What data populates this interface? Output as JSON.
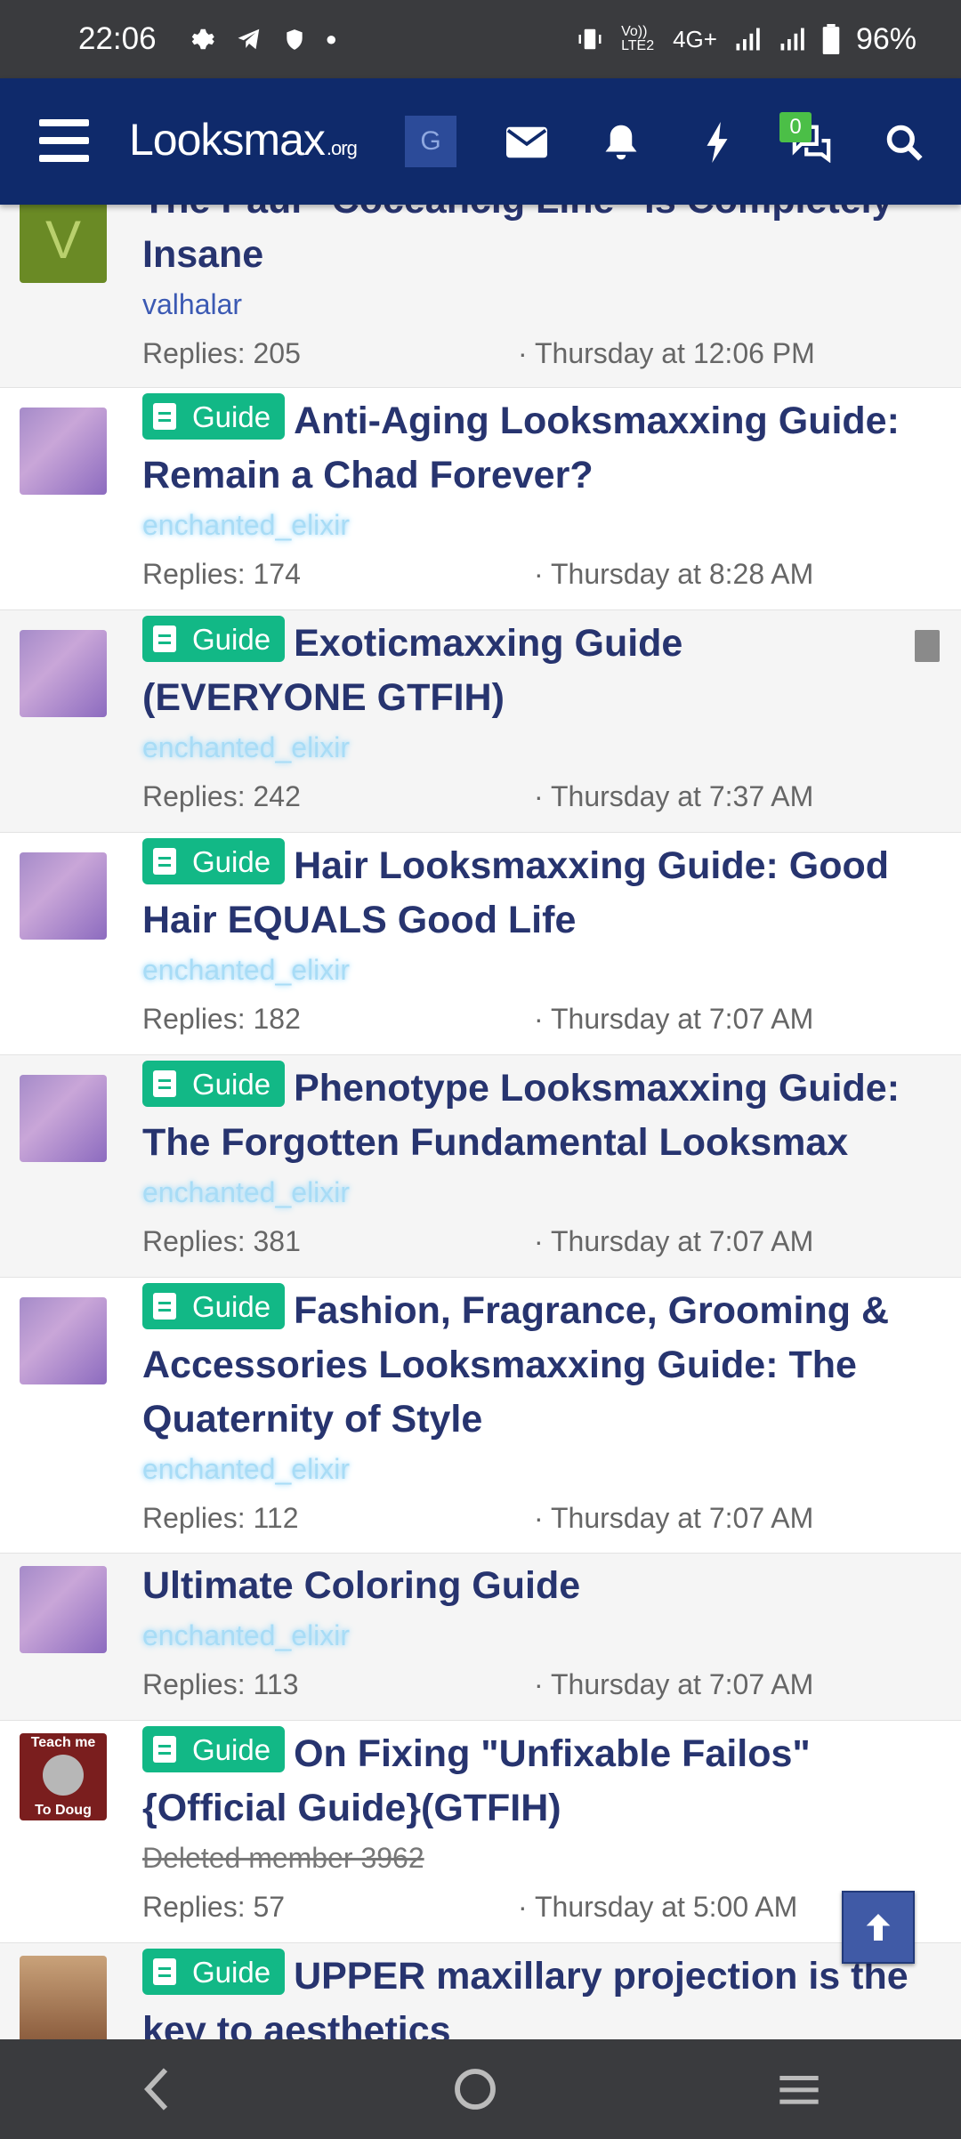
{
  "status_bar": {
    "time": "22:06",
    "network": "4G+",
    "volte": "Vo)) LTE2",
    "battery": "96%"
  },
  "header": {
    "logo_main": "Looksmax",
    "logo_suffix": ".org",
    "g_button": "G",
    "chat_badge": "0",
    "colors": {
      "navy": "#0f2a6b",
      "guide_green": "#12b886",
      "badge_green": "#4bbf47"
    }
  },
  "threads": [
    {
      "title": "The Paul “Coceancig Line” is Completely Insane",
      "label": "",
      "author": "valhalar",
      "replies": "Replies: 205",
      "date": "· Thursday at 12:06 PM"
    },
    {
      "title": "Anti-Aging Looksmaxxing Guide: Remain a Chad Forever?",
      "label": "Guide",
      "author": "enchanted_elixir",
      "replies": "Replies: 174",
      "date": "· Thursday at 8:28 AM"
    },
    {
      "title": "Exoticmaxxing Guide (EVERYONE GTFIH)",
      "label": "Guide",
      "author": "enchanted_elixir",
      "replies": "Replies: 242",
      "date": "· Thursday at 7:37 AM"
    },
    {
      "title": "Hair Looksmaxxing Guide: Good Hair EQUALS Good Life",
      "label": "Guide",
      "author": "enchanted_elixir",
      "replies": "Replies: 182",
      "date": "· Thursday at 7:07 AM"
    },
    {
      "title": "Phenotype Looksmaxxing Guide: The Forgotten Fundamental Looksmax",
      "label": "Guide",
      "author": "enchanted_elixir",
      "replies": "Replies: 381",
      "date": "· Thursday at 7:07 AM"
    },
    {
      "title": "Fashion, Fragrance, Grooming & Accessories Looksmaxxing Guide: The Quaternity of Style",
      "label": "Guide",
      "author": "enchanted_elixir",
      "replies": "Replies: 112",
      "date": "· Thursday at 7:07 AM"
    },
    {
      "title": "Ultimate Coloring Guide",
      "label": "",
      "author": "enchanted_elixir",
      "replies": "Replies: 113",
      "date": "· Thursday at 7:07 AM"
    },
    {
      "title": "On Fixing \"Unfixable Failos\"{Official Guide}(GTFIH)",
      "label": "Guide",
      "author": "Deleted member 3962",
      "replies": "Replies: 57",
      "date": "· Thursday at 5:00 AM"
    },
    {
      "title": "UPPER maxillary projection is the key to aesthetics",
      "label": "Guide",
      "author": "",
      "replies": "",
      "date": ""
    }
  ],
  "avatar_text": {
    "teach_top": "Teach me",
    "teach_bottom": "To Doug",
    "v_letter": "V"
  }
}
